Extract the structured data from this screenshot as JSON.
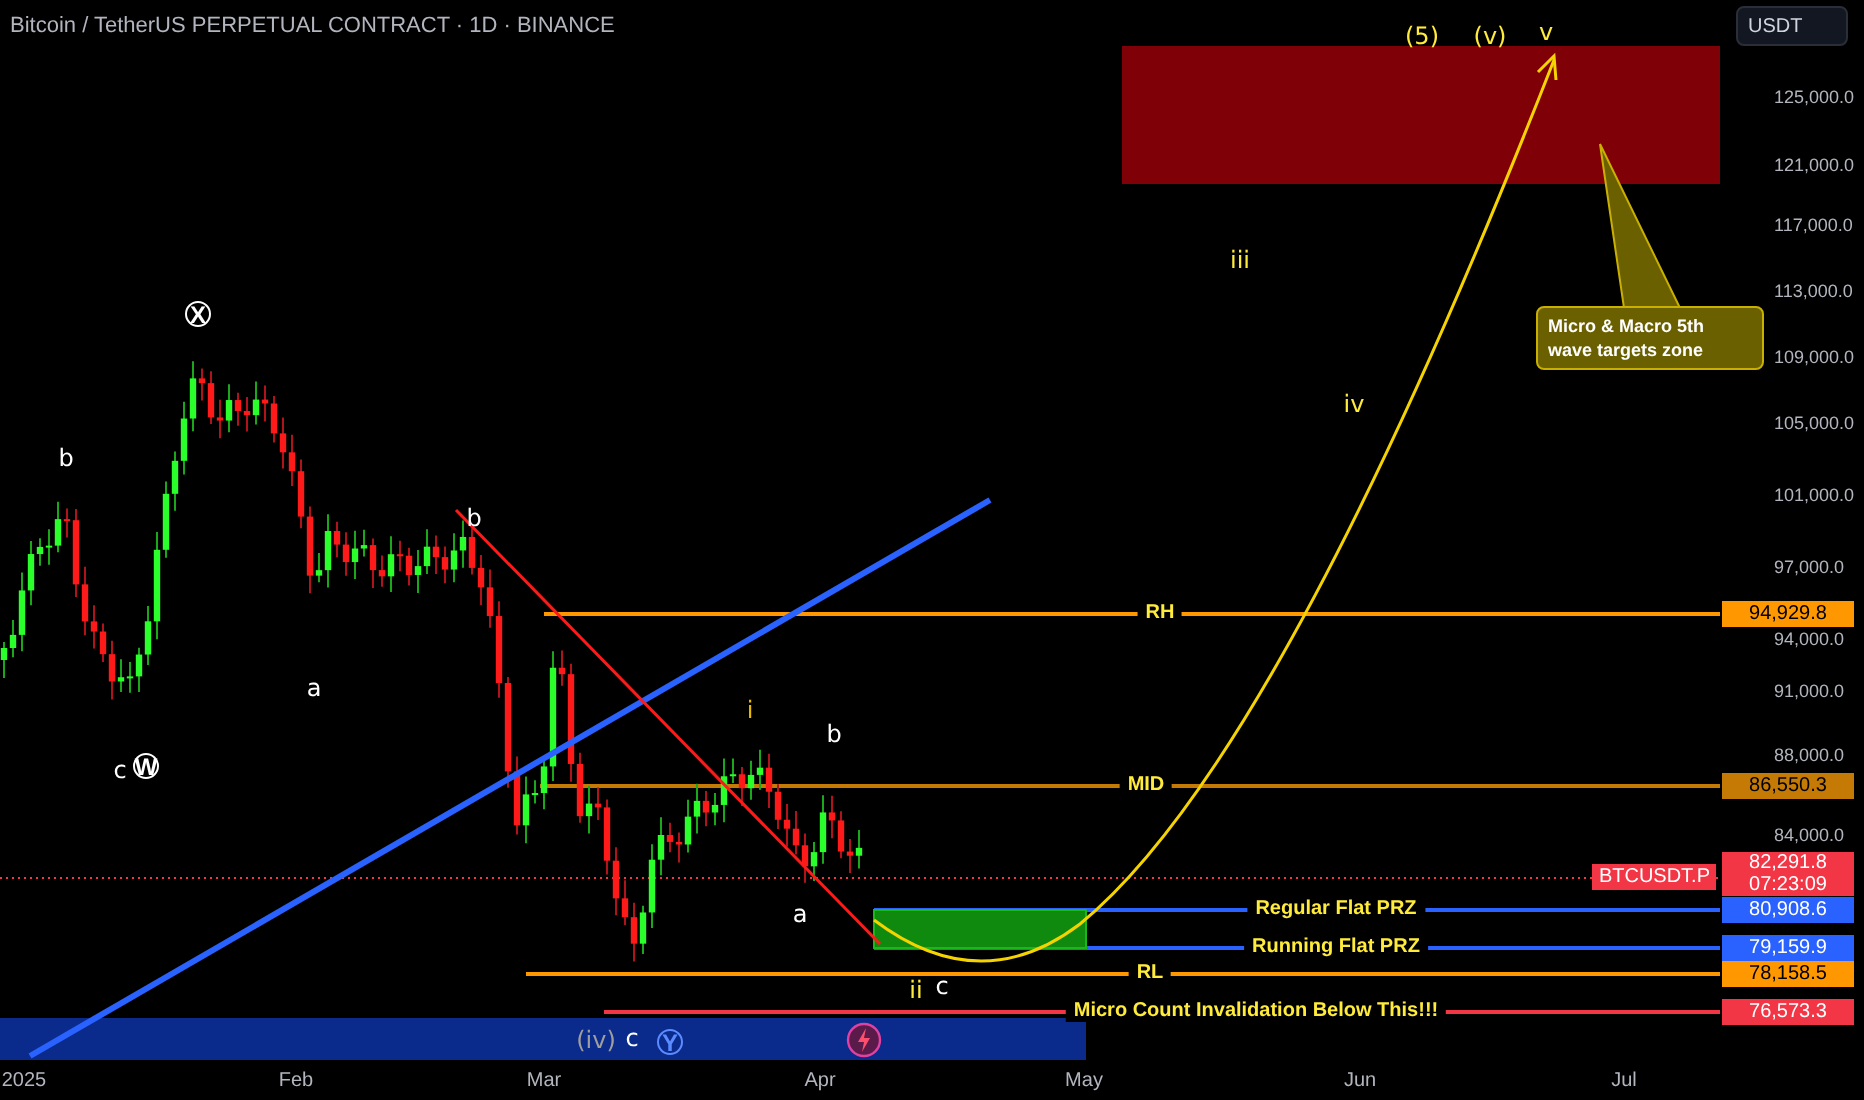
{
  "title": "Bitcoin / TetherUS PERPETUAL CONTRACT · 1D · BINANCE",
  "price_axis": {
    "currency_button": "USDT",
    "ticks": [
      "125,000.0",
      "121,000.0",
      "117,000.0",
      "113,000.0",
      "109,000.0",
      "105,000.0",
      "101,000.0",
      "97,000.0",
      "94,000.0",
      "91,000.0",
      "88,000.0",
      "84,000.0"
    ]
  },
  "levels": [
    {
      "label": "RH",
      "price": "94,929.8",
      "color": "#ff9800"
    },
    {
      "label": "MID",
      "price": "86,550.3",
      "color": "#c67a06"
    },
    {
      "label": "Regular Flat PRZ",
      "price": "80,908.6",
      "color": "#2962ff"
    },
    {
      "label": "Running Flat PRZ",
      "price": "79,159.9",
      "color": "#2962ff"
    },
    {
      "label": "RL",
      "price": "78,158.5",
      "color": "#ff9800"
    },
    {
      "label": "Micro Count Invalidation Below This!!!",
      "price": "76,573.3",
      "color": "#f23645"
    }
  ],
  "current_price": {
    "symbol": "BTCUSDT.P",
    "price": "82,291.8",
    "countdown": "07:23:09"
  },
  "wave_labels": [
    {
      "text": "b",
      "kind": "plain",
      "color": "#ffffff"
    },
    {
      "text": "X",
      "kind": "circled",
      "color": "#ffffff"
    },
    {
      "text": "a",
      "kind": "plain",
      "color": "#ffffff"
    },
    {
      "text": "c",
      "kind": "plain",
      "color": "#ffffff"
    },
    {
      "text": "W",
      "kind": "circled",
      "color": "#ffffff"
    },
    {
      "text": "b",
      "kind": "plain",
      "color": "#ffffff"
    },
    {
      "text": "i",
      "kind": "plain",
      "color": "#e6b800"
    },
    {
      "text": "b",
      "kind": "plain",
      "color": "#ffffff"
    },
    {
      "text": "a",
      "kind": "plain",
      "color": "#ffffff"
    },
    {
      "text": "ii",
      "kind": "plain",
      "color": "#ffeb3b"
    },
    {
      "text": "c",
      "kind": "plain",
      "color": "#ffffff"
    },
    {
      "text": "(iv)",
      "kind": "plain",
      "color": "#9e9e9e"
    },
    {
      "text": "c",
      "kind": "plain",
      "color": "#ffffff"
    },
    {
      "text": "Y",
      "kind": "circled",
      "color": "#5b8cff"
    },
    {
      "text": "iii",
      "kind": "plain",
      "color": "#ffeb3b"
    },
    {
      "text": "iv",
      "kind": "plain",
      "color": "#ffeb3b"
    },
    {
      "text": "(5)",
      "kind": "plain",
      "color": "#ffeb3b"
    },
    {
      "text": "(v)",
      "kind": "plain",
      "color": "#ffeb3b"
    },
    {
      "text": "v",
      "kind": "plain",
      "color": "#ffeb3b"
    }
  ],
  "callout": {
    "text": "Micro & Macro 5th wave targets zone"
  },
  "time_axis": [
    "2025",
    "Feb",
    "Mar",
    "Apr",
    "May",
    "Jun",
    "Jul"
  ]
}
